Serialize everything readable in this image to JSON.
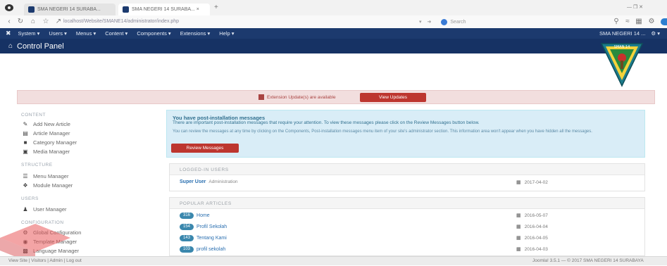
{
  "browser": {
    "tabs": [
      {
        "label": "SMA NEGERI 14 SURABA...",
        "active": false
      },
      {
        "label": "SMA NEGERI 14 SURABA... ×",
        "active": true
      }
    ],
    "new_tab": "+",
    "url": "localhost/Website/SMANE14/administrator/index.php",
    "search_placeholder": "Search",
    "window_controls": "— ❐ ✕"
  },
  "topmenu": {
    "items": [
      "System ▾",
      "Users ▾",
      "Menus ▾",
      "Content ▾",
      "Components ▾",
      "Extensions ▾",
      "Help ▾"
    ],
    "site_name": "SMA NEGERI 14 ...",
    "user": "⚙ ▾"
  },
  "title": "Control Panel",
  "update": {
    "message": "Extension Update(s) are available",
    "button": "View Updates"
  },
  "sidebar": {
    "sections": [
      {
        "heading": "CONTENT",
        "items": [
          {
            "label": "Add New Article",
            "icon": "pencil-icon"
          },
          {
            "label": "Article Manager",
            "icon": "file-icon"
          },
          {
            "label": "Category Manager",
            "icon": "folder-icon"
          },
          {
            "label": "Media Manager",
            "icon": "image-icon"
          }
        ]
      },
      {
        "heading": "STRUCTURE",
        "items": [
          {
            "label": "Menu Manager",
            "icon": "list-icon"
          },
          {
            "label": "Module Manager",
            "icon": "cube-icon"
          }
        ]
      },
      {
        "heading": "USERS",
        "items": [
          {
            "label": "User Manager",
            "icon": "user-icon"
          }
        ]
      },
      {
        "heading": "CONFIGURATION",
        "items": [
          {
            "label": "Global Configuration",
            "icon": "gear-icon"
          },
          {
            "label": "Template Manager",
            "icon": "eye-icon"
          },
          {
            "label": "Language Manager",
            "icon": "comment-icon"
          }
        ]
      }
    ]
  },
  "postinstall": {
    "heading": "You have post-installation messages",
    "text1": "There are important post-installation messages that require your attention. To view these messages please click on the Review Messages button below.",
    "text2": "You can review the messages at any time by clicking on the Components, Post-installation messages menu item of your site's administrator section. This information area won't appear when you have hidden all the messages.",
    "button": "Review Messages"
  },
  "logged_in": {
    "heading": "LOGGED-IN USERS",
    "rows": [
      {
        "name": "Super User",
        "sub": "Administration",
        "date": "2017-04-02"
      }
    ]
  },
  "popular": {
    "heading": "POPULAR ARTICLES",
    "rows": [
      {
        "hits": "316",
        "title": "Home",
        "date": "2016-05-07"
      },
      {
        "hits": "154",
        "title": "Profil Sekolah",
        "date": "2016-04-04"
      },
      {
        "hits": "143",
        "title": "Tentang Kami",
        "date": "2016-04-05"
      },
      {
        "hits": "103",
        "title": "profil sekolah",
        "date": "2016-04-03"
      }
    ]
  },
  "statusbar": {
    "left": "View Site  |  Visitors  |  Admin  |  Log out",
    "right": "Joomla! 3.5.1 — © 2017 SMA NEGERI 14 SURABAYA"
  },
  "colors": {
    "menubar": "#1c3a6e",
    "titlebar": "#163264",
    "danger": "#bd362f",
    "info_bg": "#d9edf7",
    "link": "#2a6fb0"
  }
}
